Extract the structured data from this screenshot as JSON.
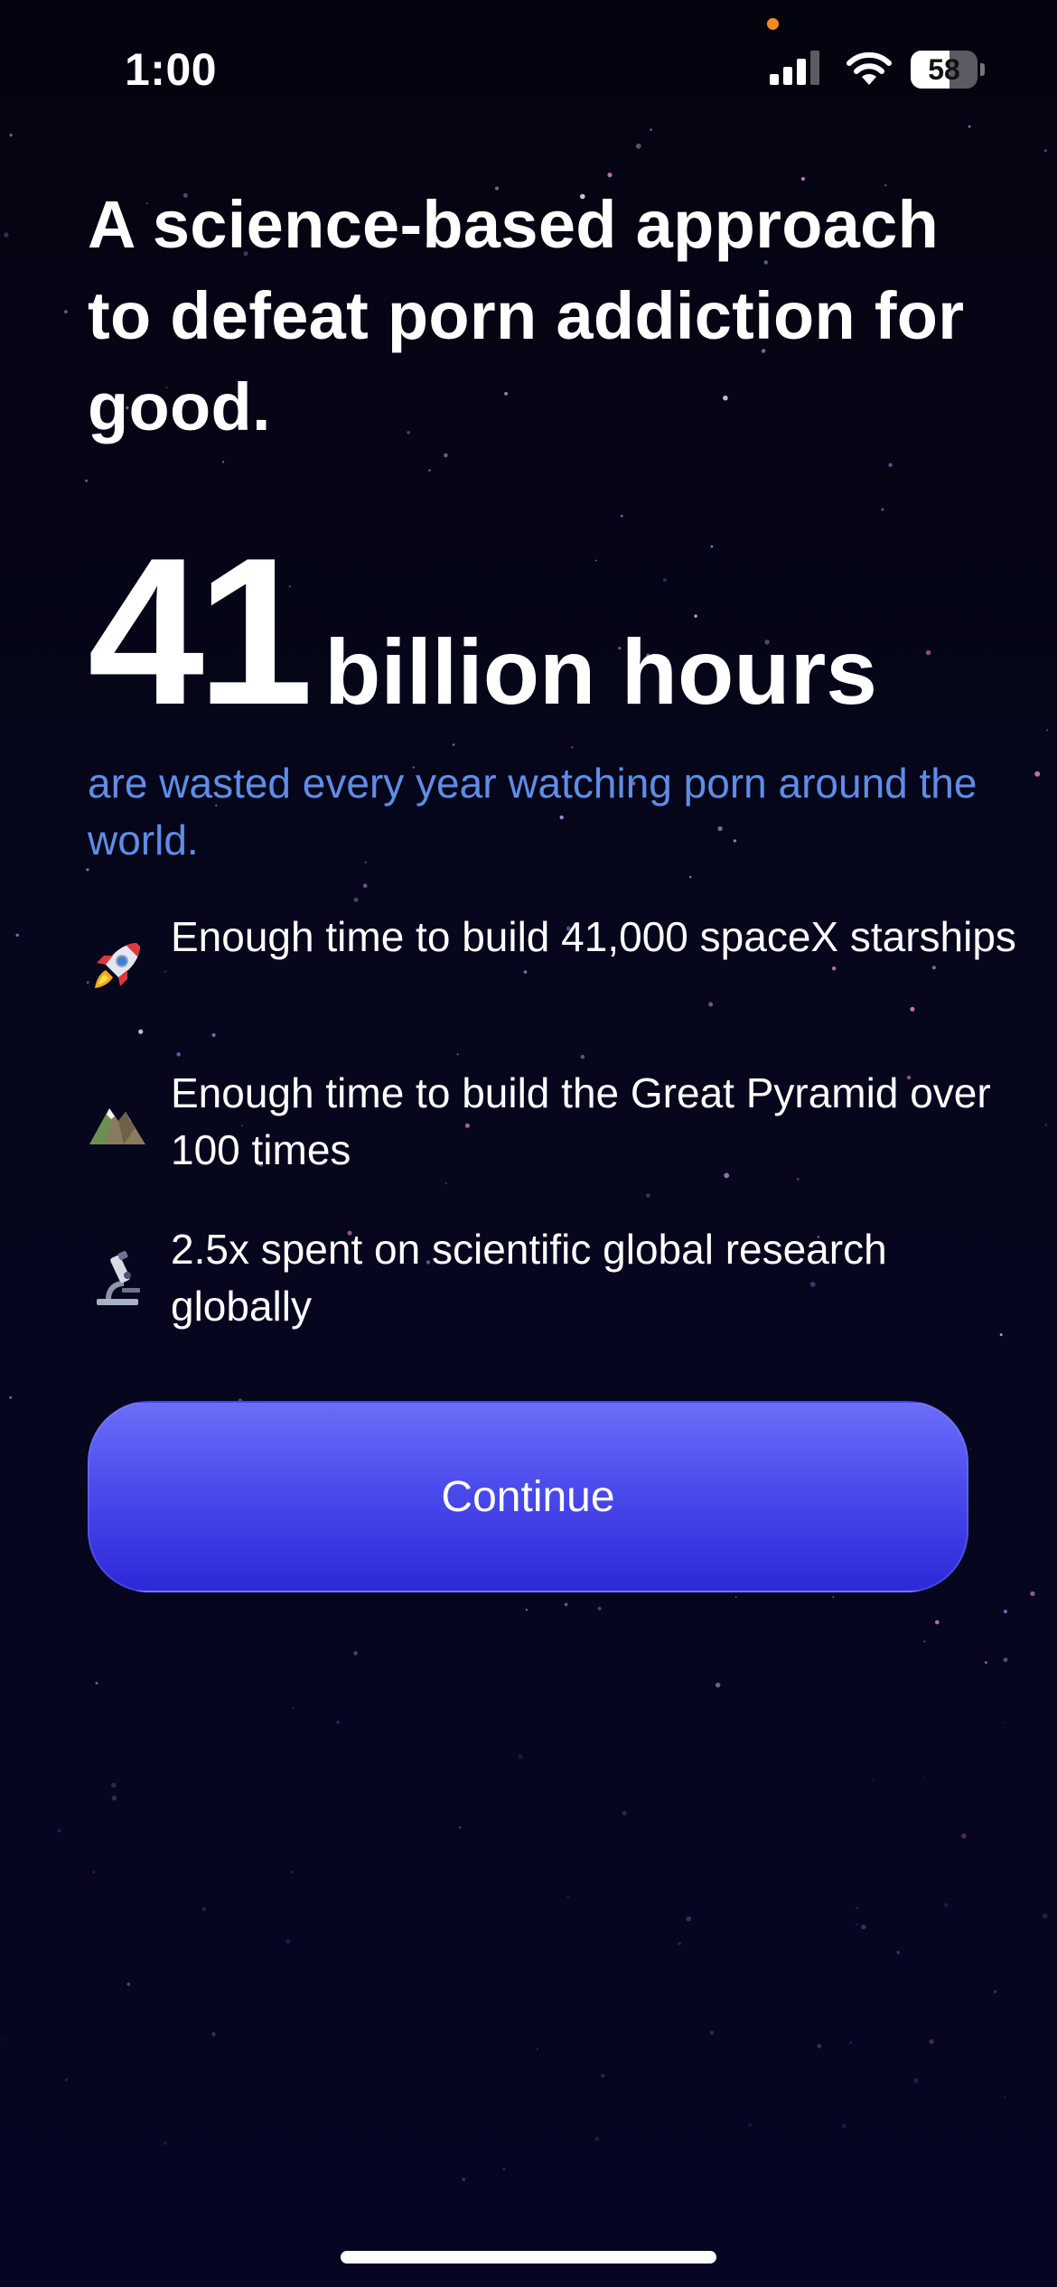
{
  "status_bar": {
    "time": "1:00",
    "battery_level": "58",
    "battery_fraction": 0.58
  },
  "headline": "A science-based approach to defeat porn addiction for good.",
  "stat": {
    "number": "41",
    "unit": "billion hours",
    "caption": "are wasted every year watching porn around the world."
  },
  "facts": [
    {
      "icon": "rocket-icon",
      "text": "Enough time to build 41,000 spaceX starships"
    },
    {
      "icon": "mountain-icon",
      "text": "Enough time to build the Great Pyramid over 100 times"
    },
    {
      "icon": "microscope-icon",
      "text": "2.5x spent on scientific global research globally"
    }
  ],
  "continue_label": "Continue",
  "colors": {
    "background": "#06061a",
    "accent_text": "#5f8de6",
    "button_top": "#6b6ef8",
    "button_bottom": "#2d28d8",
    "recording_dot": "#f08a24"
  }
}
